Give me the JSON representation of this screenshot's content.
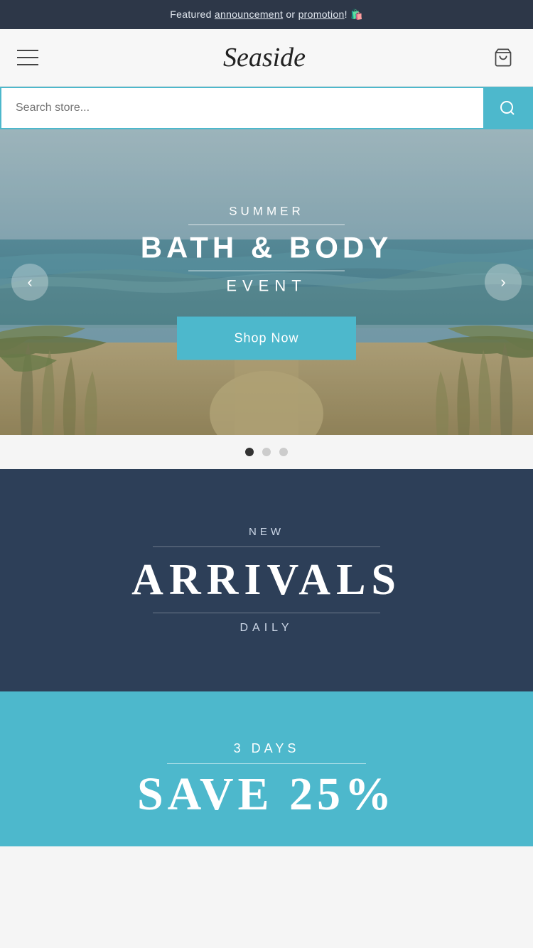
{
  "announcement": {
    "text_before": "Featured ",
    "link1": "announcement",
    "text_middle": " or ",
    "link2": "promotion",
    "text_after": "! 🛍️"
  },
  "header": {
    "logo": "Seaside",
    "cart_label": "Cart"
  },
  "search": {
    "placeholder": "Search store...",
    "button_label": "Search"
  },
  "hero": {
    "subtitle": "SUMMER",
    "title": "BATH & BODY",
    "title2": "EVENT",
    "cta": "Shop Now",
    "slide_count": 3,
    "active_slide": 0
  },
  "new_arrivals": {
    "label_top": "NEW",
    "title": "ARRIVALS",
    "label_bottom": "DAILY"
  },
  "save_section": {
    "days": "3 DAYS",
    "title": "SAVE 25%"
  },
  "slider_dots": [
    {
      "active": true
    },
    {
      "active": false
    },
    {
      "active": false
    }
  ]
}
